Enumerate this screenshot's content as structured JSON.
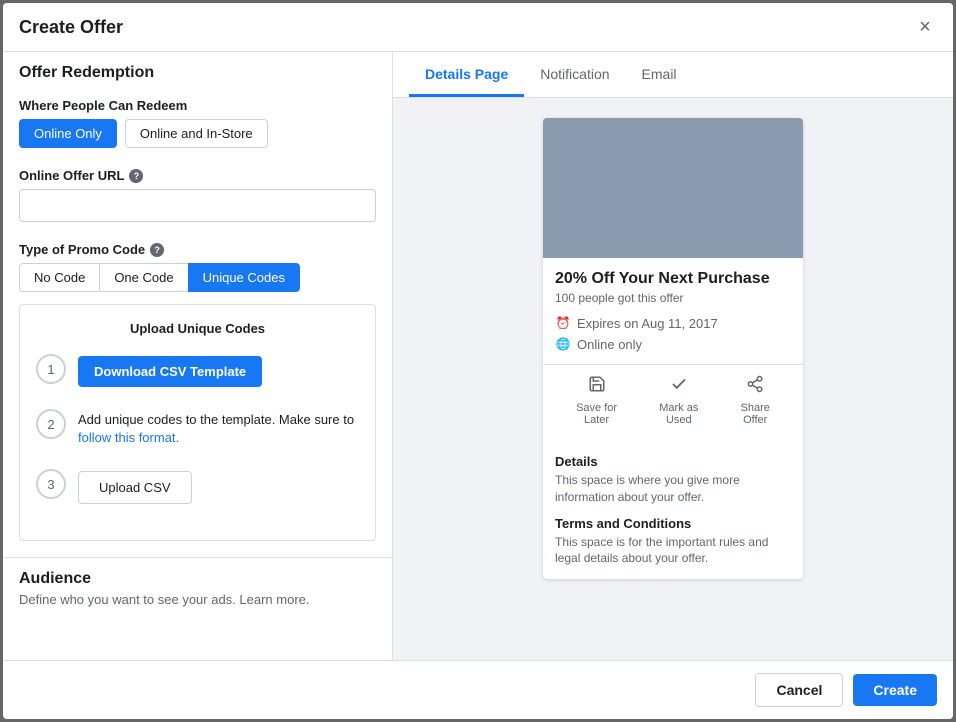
{
  "modal": {
    "title": "Create Offer",
    "close_label": "×"
  },
  "left_panel": {
    "section_title": "Offer Redemption",
    "where_label": "Where People Can Redeem",
    "buttons": {
      "online_only": "Online Only",
      "online_and_instore": "Online and In-Store"
    },
    "url_label": "Online Offer URL",
    "url_placeholder": "",
    "promo_label": "Type of Promo Code",
    "promo_buttons": {
      "no_code": "No Code",
      "one_code": "One Code",
      "unique_codes": "Unique Codes"
    },
    "upload_section": {
      "title": "Upload Unique Codes",
      "step1_btn": "Download CSV Template",
      "step2_text": "Add unique codes to the template. Make sure to ",
      "step2_link": "follow this format.",
      "step3_btn": "Upload CSV",
      "step_numbers": [
        "1",
        "2",
        "3"
      ]
    },
    "audience_title": "Audience",
    "audience_subtitle": "Define who you want to see your ads. Learn more."
  },
  "right_panel": {
    "tabs": [
      {
        "label": "Details Page",
        "active": true
      },
      {
        "label": "Notification",
        "active": false
      },
      {
        "label": "Email",
        "active": false
      }
    ],
    "offer_card": {
      "title": "20% Off Your Next Purchase",
      "claimed": "100 people got this offer",
      "expires": "Expires on Aug 11, 2017",
      "location": "Online only",
      "actions": [
        {
          "icon": "↩",
          "label": "Save for\nLater"
        },
        {
          "icon": "✓",
          "label": "Mark as\nUsed"
        },
        {
          "icon": "↗",
          "label": "Share\nOffer"
        }
      ],
      "details_title": "Details",
      "details_text": "This space is where you give more information about your offer.",
      "terms_title": "Terms and Conditions",
      "terms_text": "This space is for the important rules and legal details about your offer."
    }
  },
  "footer": {
    "cancel_label": "Cancel",
    "create_label": "Create"
  }
}
